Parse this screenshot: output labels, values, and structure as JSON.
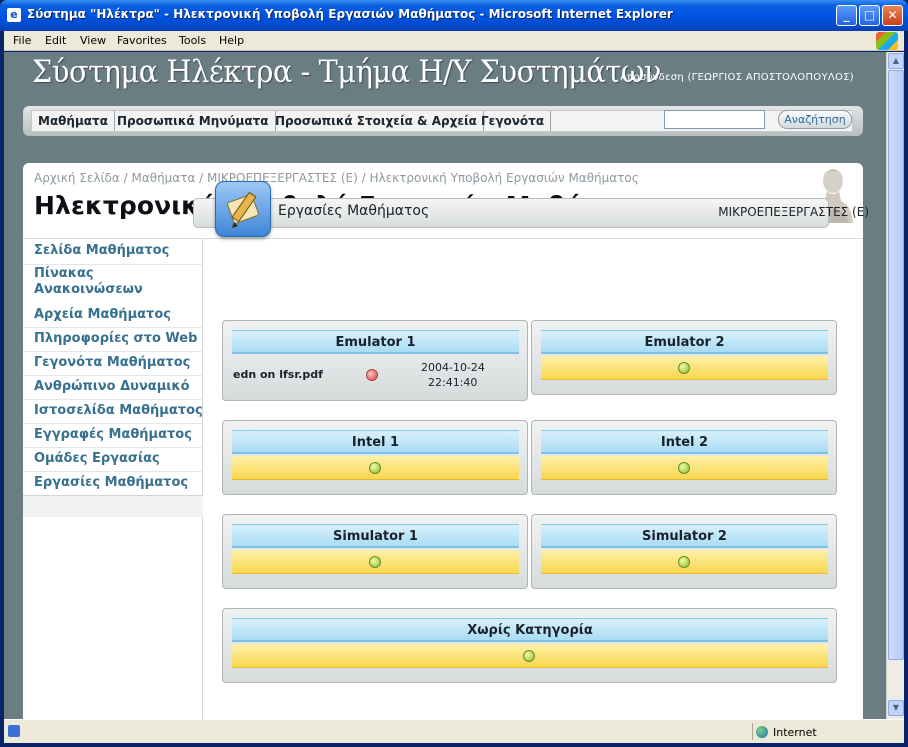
{
  "window": {
    "title": "Σύστημα \"Ηλέκτρα\" - Ηλεκτρονική Υποβολή Εργασιών Μαθήματος - Microsoft Internet Explorer",
    "minimize_icon": "minimize-icon",
    "maximize_icon": "maximize-icon",
    "close_icon": "close-icon"
  },
  "menubar": {
    "items": [
      "File",
      "Edit",
      "View",
      "Favorites",
      "Tools",
      "Help"
    ]
  },
  "header": {
    "site_title": "Σύστημα Ηλέκτρα - Τμήμα Η/Υ Συστημάτων",
    "logout": "Αποσύνδεση (ΓΕΩΡΓΙΟΣ ΑΠΟΣΤΟΛΟΠΟΥΛΟΣ)"
  },
  "nav": {
    "items": [
      "Μαθήματα",
      "Προσωπικά Μηνύματα",
      "Προσωπικά Στοιχεία & Αρχεία",
      "Γεγονότα"
    ],
    "search_value": "",
    "search_button": "Αναζήτηση"
  },
  "page": {
    "breadcrumb": "Αρχική Σελίδα / Μαθήματα / ΜΙΚΡΟΕΠΕΞΕΡΓΑΣΤΕΣ (Ε) / Ηλεκτρονική Υποβολή Εργασιών Μαθήματος",
    "title": "Ηλεκτρονική Υποβολή Εργασιών Μαθήματος"
  },
  "sidebar": {
    "items": [
      "Σελίδα Μαθήματος",
      "Πίνακας Ανακοινώσεων",
      "Αρχεία Μαθήματος",
      "Πληροφορίες στο Web",
      "Γεγονότα Μαθήματος",
      "Ανθρώπινο Δυναμικό",
      "Ιστοσελίδα Μαθήματος",
      "Εγγραφές Μαθήματος",
      "Ομάδες Εργασίας",
      "Εργασίες Μαθήματος"
    ]
  },
  "section": {
    "title": "Εργασίες Μαθήματος",
    "course": "ΜΙΚΡΟΕΠΕΞΕΡΓΑΣΤΕΣ (Ε)"
  },
  "assignments": [
    {
      "name": "Emulator 1",
      "file": "edn on lfsr.pdf",
      "date": "2004-10-24",
      "time": "22:41:40",
      "status_color": "#e46a62"
    },
    {
      "name": "Emulator 2",
      "status_color": "#a6cf46"
    },
    {
      "name": "Intel 1",
      "status_color": "#a6cf46"
    },
    {
      "name": "Intel 2",
      "status_color": "#a6cf46"
    },
    {
      "name": "Simulator 1",
      "status_color": "#a6cf46"
    },
    {
      "name": "Simulator 2",
      "status_color": "#a6cf46"
    },
    {
      "name": "Χωρίς Κατηγορία",
      "status_color": "#a6cf46"
    }
  ],
  "statusbar": {
    "zone": "Internet",
    "zone_icon": "globe-icon"
  },
  "colors": {
    "accent": "#37718f",
    "card_header": "#a9dcf4",
    "card_row": "#f8d64f"
  }
}
